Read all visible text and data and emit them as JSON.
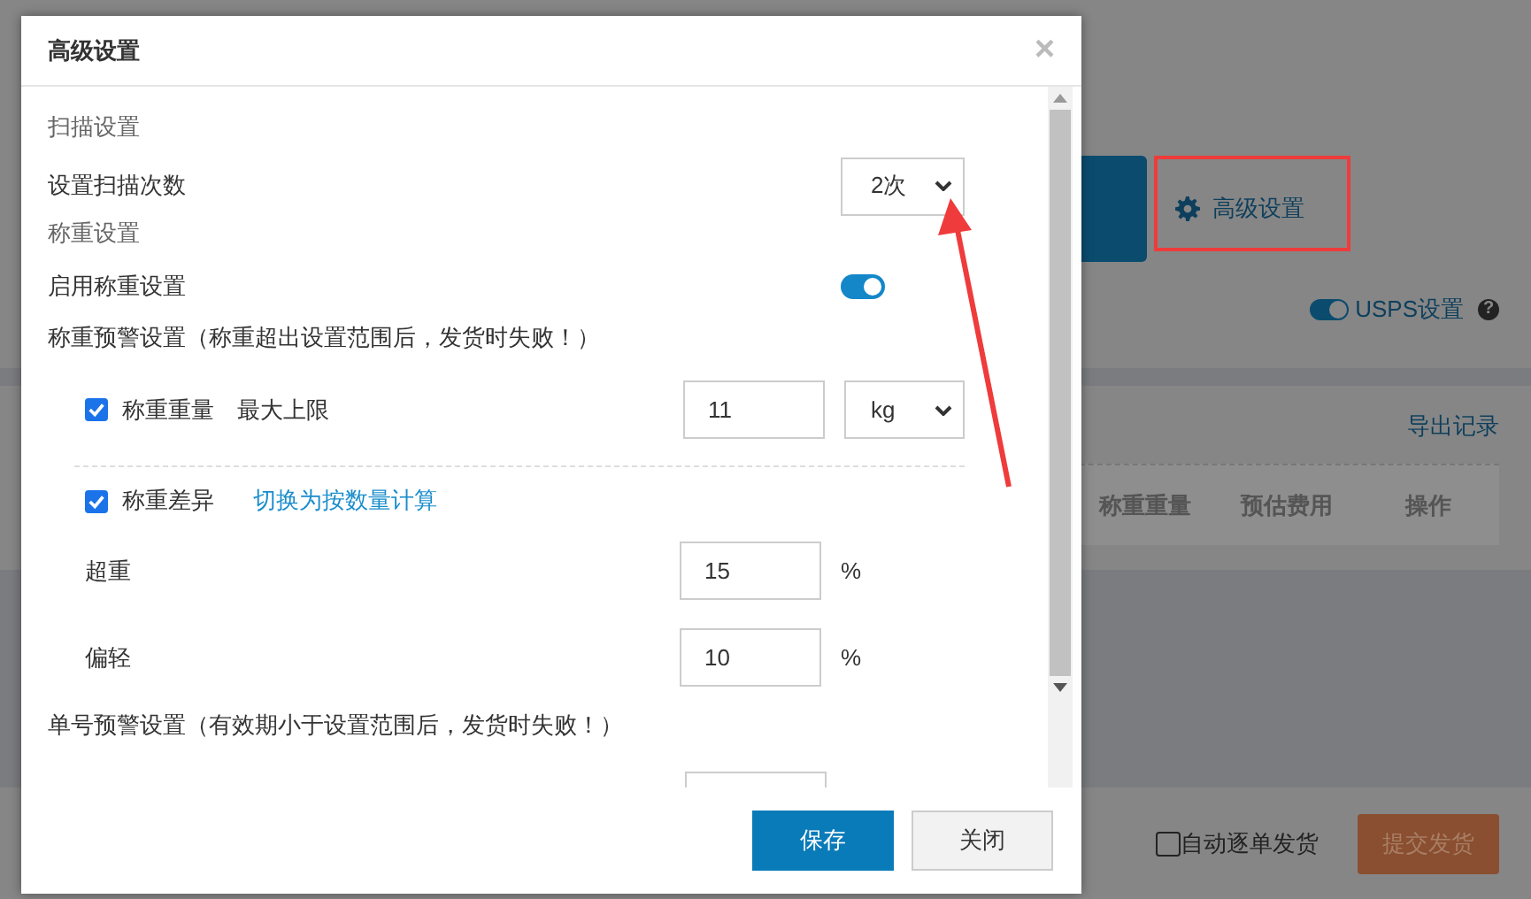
{
  "page": {
    "advanced_link": "高级设置",
    "usps": {
      "label": "USPS设置",
      "on": true
    },
    "help": "?",
    "export_link": "导出记录",
    "table_columns": [
      "称重重量",
      "预估费用",
      "操作"
    ],
    "auto_ship": {
      "label": "自动逐单发货",
      "checked": false
    },
    "submit": "提交发货"
  },
  "modal": {
    "title": "高级设置",
    "close": "×",
    "items": [
      {
        "kind": "heading",
        "text": "扫描设置"
      },
      {
        "kind": "select",
        "label": "设置扫描次数",
        "value": "2次"
      },
      {
        "kind": "heading",
        "text": "称重设置"
      },
      {
        "kind": "toggle",
        "label": "启用称重设置",
        "on": true
      },
      {
        "kind": "note",
        "text": "称重预警设置（称重超出设置范围后，发货时失败！）"
      },
      {
        "kind": "check",
        "label": "称重重量",
        "extra": "最大上限",
        "checked": true,
        "value": "11",
        "unit_select": "kg"
      },
      {
        "kind": "divider"
      },
      {
        "kind": "check",
        "label": "称重差异",
        "link": "切换为按数量计算",
        "checked": true
      },
      {
        "kind": "input",
        "label": "超重",
        "value": "15",
        "unit": "%"
      },
      {
        "kind": "input",
        "label": "偏轻",
        "value": "10",
        "unit": "%"
      },
      {
        "kind": "note",
        "text": "单号预警设置（有效期小于设置范围后，发货时失败！）"
      },
      {
        "kind": "cut_input"
      }
    ],
    "buttons": [
      {
        "label": "保存",
        "primary": true
      },
      {
        "label": "关闭",
        "primary": false
      }
    ]
  }
}
